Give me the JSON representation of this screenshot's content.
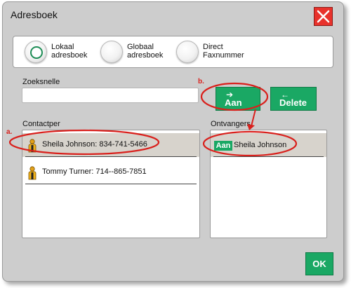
{
  "dialog": {
    "title": "Adresboek",
    "close_icon": "close-x-icon"
  },
  "source_options": [
    {
      "label": "Lokaal\nadresboek",
      "selected": true
    },
    {
      "label": "Globaal\nadresboek",
      "selected": false
    },
    {
      "label": "Direct\nFaxnummer",
      "selected": false
    }
  ],
  "search": {
    "label": "Zoeksnelle",
    "value": ""
  },
  "buttons": {
    "add_label": "Aan",
    "add_icon": "arrow-right-icon",
    "delete_label": "Delete",
    "delete_icon": "arrow-left-icon",
    "ok_label": "OK"
  },
  "contacts": {
    "label": "Contactper",
    "items": [
      {
        "text": "Sheila Johnson: 834-741-5466",
        "selected": true,
        "icon": "person-icon"
      },
      {
        "text": "Tommy Turner: 714--865-7851",
        "selected": false,
        "icon": "person-icon"
      }
    ]
  },
  "recipients": {
    "label": "Ontvangers",
    "items": [
      {
        "badge": "Aan",
        "text": "Sheila Johnson",
        "selected": true
      }
    ]
  },
  "annotations": {
    "a": "a.",
    "b": "b.",
    "color": "#d9201c"
  },
  "colors": {
    "accent_green": "#1aa864",
    "close_red": "#e8322c",
    "dialog_bg": "#cdcdcd"
  }
}
